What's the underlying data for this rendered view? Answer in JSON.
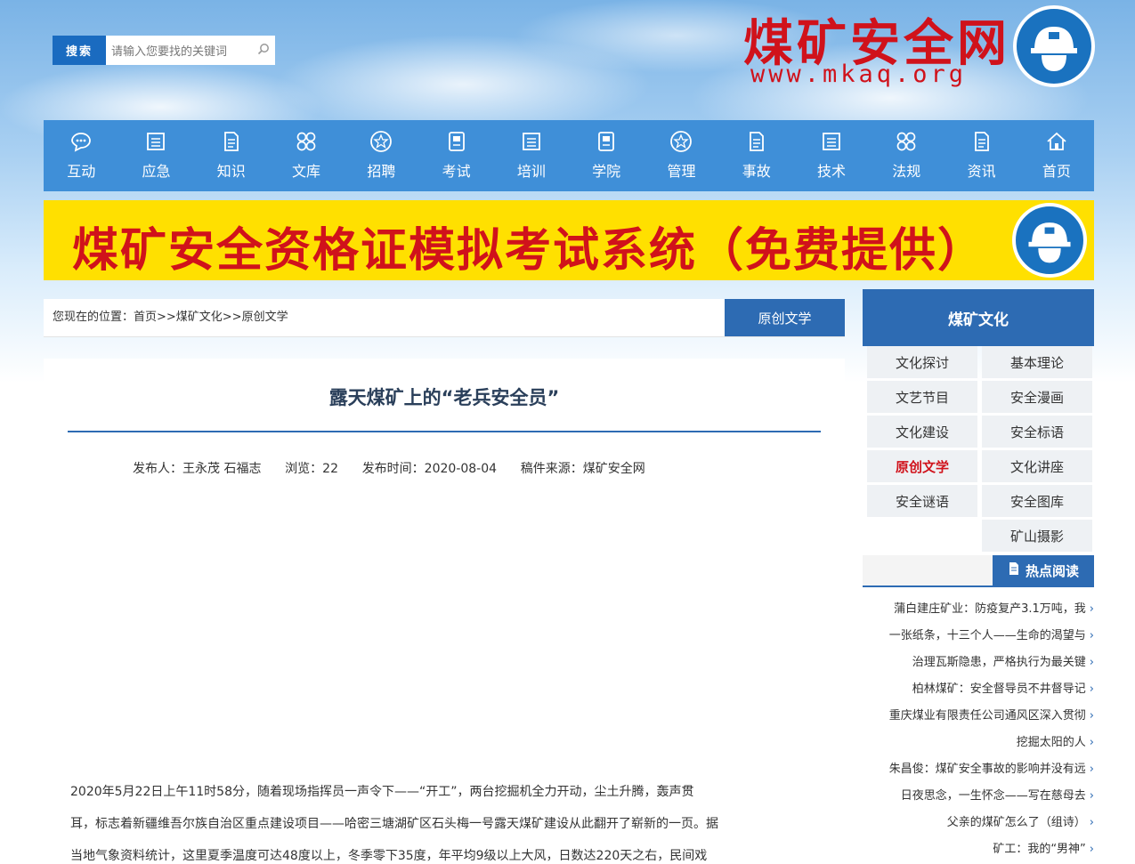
{
  "header": {
    "search_button": "搜索",
    "search_placeholder": "请输入您要找的关键词",
    "logo_title": "煤矿安全网",
    "logo_url": "www.mkaq.org"
  },
  "nav": {
    "items": [
      {
        "label": "首页",
        "icon": "home-icon"
      },
      {
        "label": "资讯",
        "icon": "document-icon"
      },
      {
        "label": "法规",
        "icon": "grid-icon"
      },
      {
        "label": "技术",
        "icon": "list-icon"
      },
      {
        "label": "事故",
        "icon": "document-icon"
      },
      {
        "label": "管理",
        "icon": "star-circle-icon"
      },
      {
        "label": "学院",
        "icon": "book-icon"
      },
      {
        "label": "培训",
        "icon": "list-icon"
      },
      {
        "label": "考试",
        "icon": "book-icon"
      },
      {
        "label": "招聘",
        "icon": "star-circle-icon"
      },
      {
        "label": "文库",
        "icon": "grid-icon"
      },
      {
        "label": "知识",
        "icon": "document-icon"
      },
      {
        "label": "应急",
        "icon": "list-icon"
      },
      {
        "label": "互动",
        "icon": "chat-icon"
      }
    ]
  },
  "banner": {
    "text": "煤矿安全资格证模拟考试系统（免费提供）"
  },
  "breadcrumb": {
    "text": "您现在的位置：首页>>煤矿文化>>原创文学",
    "section_tag": "原创文学"
  },
  "article": {
    "title": "露天煤矿上的“老兵安全员”",
    "publisher": "发布人：王永茂 石福志",
    "views": "浏览：22",
    "published": "发布时间：2020-08-04",
    "source": "稿件来源：煤矿安全网",
    "paragraphs": [
      "2020年5月22日上午11时58分，随着现场指挥员一声令下——“开工”，两台挖掘机全力开动，尘土升腾，轰声贯",
      "耳，标志着新疆维吾尔族自治区重点建设项目——哈密三塘湖矿区石头梅一号露天煤矿建设从此翻开了崭新的一页。据",
      "当地气象资料统计，这里夏季温度可达48度以上，冬季零下35度，年平均9级以上大风，日数达220天之右，民间戏"
    ]
  },
  "sidebar": {
    "heading": "煤矿文化",
    "categories": [
      {
        "label": "基本理论",
        "active": false
      },
      {
        "label": "文化探讨",
        "active": false
      },
      {
        "label": "安全漫画",
        "active": false
      },
      {
        "label": "文艺节目",
        "active": false
      },
      {
        "label": "安全标语",
        "active": false
      },
      {
        "label": "文化建设",
        "active": false
      },
      {
        "label": "文化讲座",
        "active": false
      },
      {
        "label": "原创文学",
        "active": true
      },
      {
        "label": "安全图库",
        "active": false
      },
      {
        "label": "安全谜语",
        "active": false
      },
      {
        "label": "矿山摄影",
        "active": false
      }
    ],
    "hot_heading": "热点阅读",
    "hot_items": [
      "蒲白建庄矿业：防疫复产3.1万吨，我",
      "一张纸条，十三个人——生命的渴望与",
      "治理瓦斯隐患，严格执行为最关键",
      "柏林煤矿：安全督导员不井督导记",
      "重庆煤业有限责任公司通风区深入贯彻",
      "挖掘太阳的人",
      "朱昌俊：煤矿安全事故的影响并没有远",
      "日夜思念，一生怀念——写在慈母去",
      "父亲的煤矿怎么了（组诗）",
      "矿工：我的“男神”"
    ]
  },
  "colors": {
    "brand_red": "#d0121b",
    "nav_blue": "#3f8fd8",
    "accent_blue": "#2d6bb3",
    "banner_yellow": "#ffe000"
  }
}
